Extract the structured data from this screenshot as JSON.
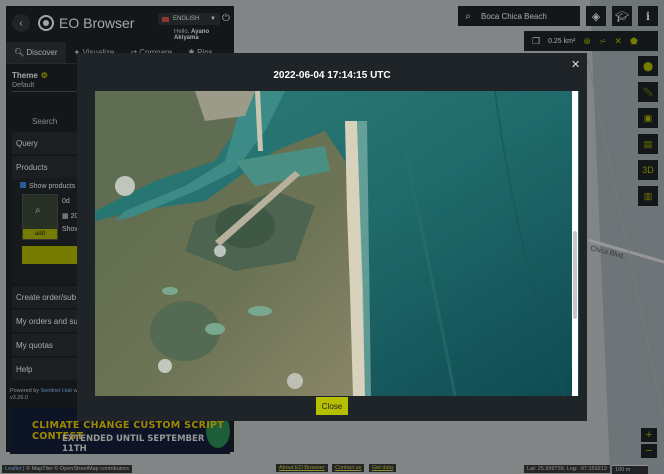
{
  "app": {
    "title": "EO Browser",
    "language": "ENGLISH",
    "greeting": "Hello,",
    "user_name": "Ayano Akiyama"
  },
  "tabs": [
    {
      "label": "Discover",
      "icon": "search-icon"
    },
    {
      "label": "Visualize",
      "icon": "visualize-icon"
    },
    {
      "label": "Compare",
      "icon": "compare-icon"
    },
    {
      "label": "Pins",
      "icon": "pin-icon"
    }
  ],
  "sidebar": {
    "theme_label": "Theme",
    "theme_value": "Default",
    "search_label": "Search",
    "query_label": "Query",
    "products_label": "Products",
    "show_products": "Show products",
    "thumb_add": "add",
    "thumb_info1": "0d",
    "thumb_info2": "20",
    "thumb_info3": "Show",
    "menu": [
      "Create order/sub",
      "My orders and su",
      "My quotas",
      "Help"
    ],
    "powered_by": "Powered by",
    "powered_link": "Sentinel Hub",
    "powered_by_suffix": "with",
    "version": "v3.26.0",
    "banner_line1": "CLIMATE CHANGE CUSTOM SCRIPT CONTEST",
    "banner_line2": "EXTENDED UNTIL SEPTEMBER 11TH"
  },
  "search": {
    "value": "Boca Chica Beach"
  },
  "toolbar": {
    "area": "0.25 km²"
  },
  "map": {
    "road_label": "Chica Blvd."
  },
  "bottom": {
    "attribution_prefix": "Leaflet",
    "attribution_rest": "| © MapTiler © OpenStreetMap contributors",
    "links": [
      "About EO Browser",
      "Contact us",
      "Get data"
    ],
    "coords": "Lat: 25.999739, Lng: -97.159213",
    "scale": "100 m"
  },
  "modal": {
    "title": "2022-06-04 17:14:15 UTC",
    "close_label": "Close"
  },
  "colors": {
    "accent": "#b6bf00",
    "panel": "#1f2428"
  }
}
